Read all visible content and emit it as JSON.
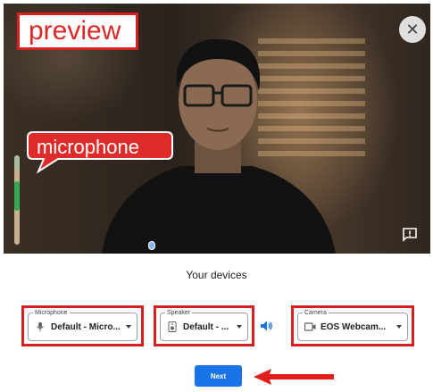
{
  "preview": {
    "annotation_label": "preview",
    "close_icon": "close-icon",
    "feedback_icon": "feedback-icon"
  },
  "microphone_annotation": {
    "label": "microphone"
  },
  "mic_level": 0.55,
  "devices": {
    "title": "Your devices",
    "microphone": {
      "legend": "Microphone",
      "value": "Default - Micro...",
      "icon": "microphone-icon"
    },
    "speaker": {
      "legend": "Speaker",
      "value": "Default - ...",
      "icon": "speaker-icon",
      "test_icon": "speaker-test-icon"
    },
    "camera": {
      "legend": "Camera",
      "value": "EOS Webcam...",
      "icon": "camera-icon"
    }
  },
  "next_button": {
    "label": "Next"
  },
  "colors": {
    "annotation_red": "#d61f1f",
    "primary_blue": "#1a73e8",
    "level_green": "#34a853"
  }
}
